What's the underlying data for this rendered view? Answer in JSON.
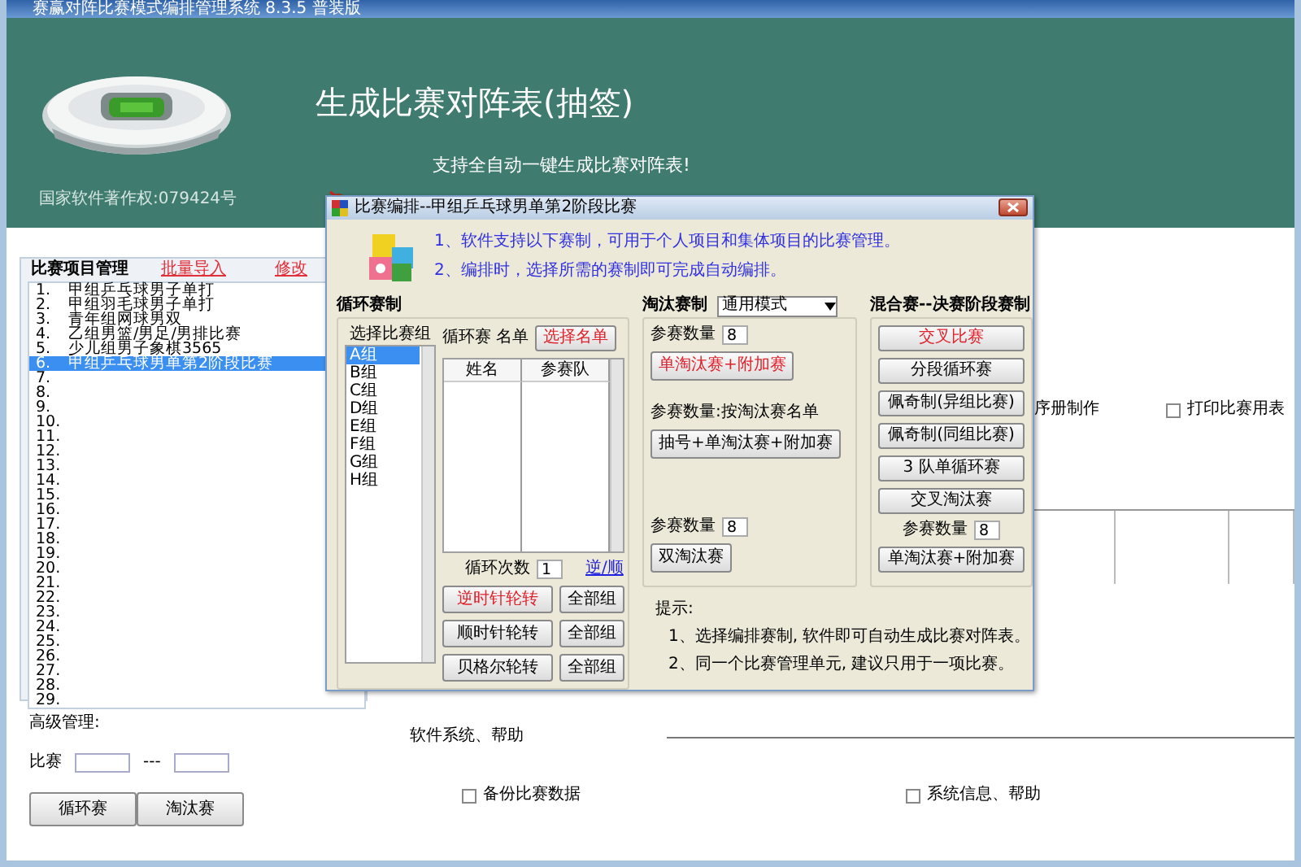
{
  "window": {
    "title": "赛赢对阵比赛模式编排管理系统 8.3.5 普装版"
  },
  "banner": {
    "title": "生成比赛对阵表(抽签)",
    "subtitle": "支持全自动一键生成比赛对阵表!",
    "copyright": "国家软件著作权:079424号"
  },
  "project_panel": {
    "title": "比赛项目管理",
    "links": [
      "批量导入",
      "修改"
    ],
    "items": [
      {
        "number": "1.",
        "name": "甲组乒乓球男子单打",
        "selected": false
      },
      {
        "number": "2.",
        "name": "甲组羽毛球男子单打",
        "selected": false
      },
      {
        "number": "3.",
        "name": "青年组网球男双",
        "selected": false
      },
      {
        "number": "4.",
        "name": "乙组男篮/男足/男排比赛",
        "selected": false
      },
      {
        "number": "5.",
        "name": "少儿组男子象棋3565",
        "selected": false
      },
      {
        "number": "6.",
        "name": "甲组乒乓球男单第2阶段比赛",
        "selected": true
      },
      {
        "number": "7.",
        "selected": false
      },
      {
        "number": "8.",
        "selected": false
      },
      {
        "number": "9.",
        "selected": false
      },
      {
        "number": "10.",
        "selected": false
      },
      {
        "number": "11.",
        "selected": false
      },
      {
        "number": "12.",
        "selected": false
      },
      {
        "number": "13.",
        "selected": false
      },
      {
        "number": "14.",
        "selected": false
      },
      {
        "number": "15.",
        "selected": false
      },
      {
        "number": "16.",
        "selected": false
      },
      {
        "number": "17.",
        "selected": false
      },
      {
        "number": "18.",
        "selected": false
      },
      {
        "number": "19.",
        "selected": false
      },
      {
        "number": "20.",
        "selected": false
      },
      {
        "number": "21.",
        "selected": false
      },
      {
        "number": "22.",
        "selected": false
      },
      {
        "number": "23.",
        "selected": false
      },
      {
        "number": "24.",
        "selected": false
      },
      {
        "number": "25.",
        "selected": false
      },
      {
        "number": "26.",
        "selected": false
      },
      {
        "number": "27.",
        "selected": false
      },
      {
        "number": "28.",
        "selected": false
      },
      {
        "number": "29.",
        "selected": false
      }
    ]
  },
  "right_area": {
    "label": "序册制作",
    "print_option": {
      "label": "打印比赛用表",
      "checked": false
    }
  },
  "advanced": {
    "title": "高级管理:",
    "range_label": "比赛",
    "separator": "---",
    "buttons": [
      "循环赛",
      "淘汰赛"
    ]
  },
  "system": {
    "title": "软件系统、帮助",
    "options": [
      {
        "label": "备份比赛数据",
        "checked": false
      },
      {
        "label": "系统信息、帮助",
        "checked": false
      }
    ]
  },
  "dialog": {
    "title": "比赛编排--甲组乒乓球男单第2阶段比赛",
    "notes": [
      "1、软件支持以下赛制，可用于个人项目和集体项目的比赛管理。",
      "2、编排时，选择所需的赛制即可完成自动编排。"
    ],
    "round_robin": {
      "title": "循环赛制",
      "group_label": "选择比赛组",
      "groups": [
        {
          "label": "A组",
          "selected": true
        },
        {
          "label": "B组",
          "selected": false
        },
        {
          "label": "C组",
          "selected": false
        },
        {
          "label": "D组",
          "selected": false
        },
        {
          "label": "E组",
          "selected": false
        },
        {
          "label": "F组",
          "selected": false
        },
        {
          "label": "G组",
          "selected": false
        },
        {
          "label": "H组",
          "selected": false
        }
      ],
      "list_label": "循环赛 名单",
      "pick_button": "选择名单",
      "columns": [
        "姓名",
        "参赛队"
      ],
      "cycles_label": "循环次数",
      "cycles": "1",
      "order_link": "逆/顺",
      "rotations": [
        {
          "label": "逆时针轮转",
          "emphasized": true,
          "all_button": "全部组"
        },
        {
          "label": "顺时针轮转",
          "emphasized": false,
          "all_button": "全部组"
        },
        {
          "label": "贝格尔轮转",
          "emphasized": false,
          "all_button": "全部组"
        }
      ]
    },
    "knockout": {
      "title": "淘汰赛制",
      "mode": "通用模式",
      "blocks": [
        {
          "count_label": "参赛数量",
          "count": "8",
          "button": "单淘汰赛+附加赛",
          "emphasized": true
        },
        {
          "count_label": "参赛数量:按淘汰赛名单",
          "button": "抽号+单淘汰赛+附加赛",
          "emphasized": false
        },
        {
          "count_label": "参赛数量",
          "count": "8",
          "button": "双淘汰赛",
          "emphasized": false
        }
      ]
    },
    "mixed": {
      "title": "混合赛--决赛阶段赛制",
      "buttons": [
        {
          "label": "交叉比赛",
          "emphasized": true
        },
        {
          "label": "分段循环赛",
          "emphasized": false
        },
        {
          "label": "佩奇制(异组比赛)",
          "emphasized": false
        },
        {
          "label": "佩奇制(同组比赛)",
          "emphasized": false
        },
        {
          "label": "3 队单循环赛",
          "emphasized": false
        },
        {
          "label": "交叉淘汰赛",
          "emphasized": false
        }
      ],
      "count_label": "参赛数量",
      "count": "8",
      "final_button": {
        "label": "单淘汰赛+附加赛",
        "emphasized": false
      }
    },
    "tips": {
      "title": "提示:",
      "lines": [
        "1、选择编排赛制, 软件即可自动生成比赛对阵表。",
        "2、同一个比赛管理单元, 建议只用于一项比赛。"
      ]
    }
  }
}
